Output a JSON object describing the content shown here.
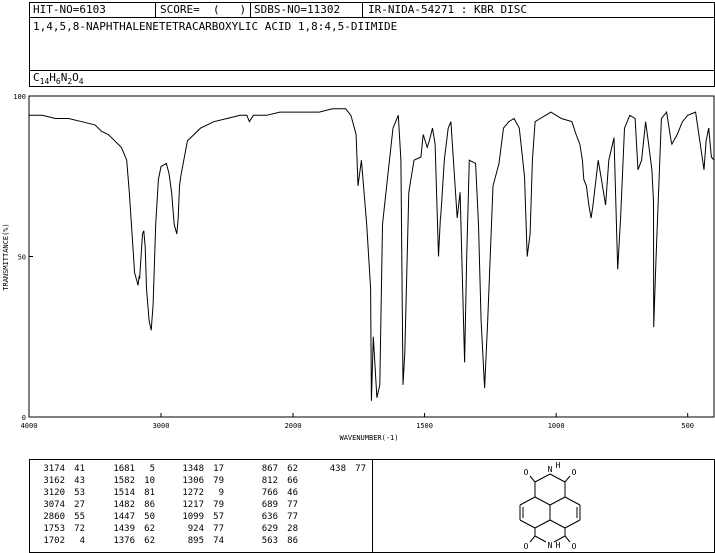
{
  "header": {
    "hit_no": "HIT-NO=6103",
    "score": "SCORE=  (   )",
    "sdbs_no": "SDBS-NO=11302",
    "ir_info": "IR-NIDA-54271 : KBR DISC",
    "compound": "1,4,5,8-NAPHTHALENETETRACARBOXYLIC ACID 1,8:4,5-DIIMIDE",
    "formula_parts": [
      "C",
      "14",
      "H",
      "6",
      "N",
      "2",
      "O",
      "4"
    ]
  },
  "chart_data": {
    "type": "line",
    "xlabel": "WAVENUMBER(-1)",
    "ylabel": "TRANSMITTANCE(%)",
    "xlim": [
      4000,
      400
    ],
    "ylim": [
      0,
      100
    ],
    "x_ticks": [
      4000,
      3000,
      2000,
      1500,
      1000,
      500
    ],
    "y_ticks": [
      0,
      50,
      100
    ],
    "grid": false,
    "series": [
      {
        "x": [
          4000,
          3900,
          3800,
          3700,
          3600,
          3500,
          3450,
          3400,
          3350,
          3300,
          3260,
          3240,
          3200,
          3180,
          3174,
          3165,
          3162,
          3140,
          3130,
          3120,
          3110,
          3090,
          3074,
          3060,
          3040,
          3020,
          3000,
          2960,
          2940,
          2920,
          2900,
          2880,
          2870,
          2860,
          2850,
          2800,
          2700,
          2600,
          2500,
          2400,
          2350,
          2330,
          2300,
          2200,
          2100,
          2000,
          1950,
          1900,
          1850,
          1800,
          1780,
          1760,
          1753,
          1740,
          1720,
          1705,
          1702,
          1695,
          1681,
          1670,
          1660,
          1640,
          1620,
          1600,
          1590,
          1582,
          1575,
          1560,
          1540,
          1514,
          1505,
          1490,
          1482,
          1470,
          1460,
          1447,
          1440,
          1439,
          1435,
          1425,
          1410,
          1400,
          1376,
          1365,
          1348,
          1340,
          1330,
          1306,
          1295,
          1285,
          1272,
          1260,
          1240,
          1217,
          1200,
          1180,
          1160,
          1140,
          1120,
          1110,
          1099,
          1090,
          1080,
          1060,
          1040,
          1020,
          1000,
          980,
          940,
          924,
          910,
          900,
          895,
          885,
          876,
          867,
          860,
          840,
          830,
          812,
          800,
          780,
          766,
          755,
          740,
          720,
          700,
          689,
          675,
          660,
          650,
          636,
          630,
          629,
          620,
          600,
          580,
          563,
          560,
          540,
          520,
          500,
          470,
          438,
          430,
          420,
          410,
          400
        ],
        "y": [
          94,
          94,
          93,
          93,
          92,
          91,
          89,
          88,
          86,
          84,
          80,
          70,
          45,
          42,
          41,
          44,
          43,
          57,
          58,
          53,
          40,
          30,
          27,
          35,
          60,
          74,
          78,
          79,
          76,
          70,
          60,
          57,
          62,
          72,
          75,
          86,
          90,
          92,
          93,
          94,
          94,
          92,
          94,
          94,
          95,
          95,
          95,
          95,
          96,
          96,
          94,
          88,
          72,
          80,
          60,
          40,
          5,
          25,
          6,
          10,
          60,
          75,
          90,
          94,
          80,
          10,
          20,
          70,
          80,
          81,
          88,
          84,
          86,
          90,
          85,
          50,
          62,
          62,
          67,
          80,
          90,
          92,
          62,
          70,
          17,
          50,
          80,
          79,
          60,
          30,
          9,
          30,
          72,
          79,
          90,
          92,
          93,
          90,
          75,
          50,
          57,
          80,
          92,
          93,
          94,
          95,
          94,
          93,
          92,
          88,
          85,
          80,
          74,
          72,
          66,
          62,
          66,
          80,
          75,
          66,
          80,
          87,
          46,
          62,
          90,
          94,
          93,
          77,
          80,
          92,
          86,
          77,
          67,
          28,
          50,
          93,
          95,
          86,
          85,
          88,
          92,
          94,
          95,
          77,
          86,
          90,
          81,
          80
        ]
      }
    ],
    "peak_table": [
      [
        [
          "3174",
          "41"
        ],
        [
          "3162",
          "43"
        ],
        [
          "3120",
          "53"
        ],
        [
          "3074",
          "27"
        ],
        [
          "2860",
          "55"
        ],
        [
          "1753",
          "72"
        ],
        [
          "1702",
          "4"
        ]
      ],
      [
        [
          "1681",
          "5"
        ],
        [
          "1582",
          "10"
        ],
        [
          "1514",
          "81"
        ],
        [
          "1482",
          "86"
        ],
        [
          "1447",
          "50"
        ],
        [
          "1439",
          "62"
        ],
        [
          "1376",
          "62"
        ]
      ],
      [
        [
          "1348",
          "17"
        ],
        [
          "1306",
          "79"
        ],
        [
          "1272",
          "9"
        ],
        [
          "1217",
          "79"
        ],
        [
          "1099",
          "57"
        ],
        [
          "924",
          "77"
        ],
        [
          "895",
          "74"
        ]
      ],
      [
        [
          "867",
          "62"
        ],
        [
          "812",
          "66"
        ],
        [
          "766",
          "46"
        ],
        [
          "689",
          "77"
        ],
        [
          "636",
          "77"
        ],
        [
          "629",
          "28"
        ],
        [
          "563",
          "86"
        ]
      ],
      [
        [
          "438",
          "77"
        ]
      ]
    ]
  },
  "structure": {
    "atoms": [
      "O",
      "N",
      "H",
      "O",
      "O",
      "N",
      "H",
      "O"
    ]
  }
}
